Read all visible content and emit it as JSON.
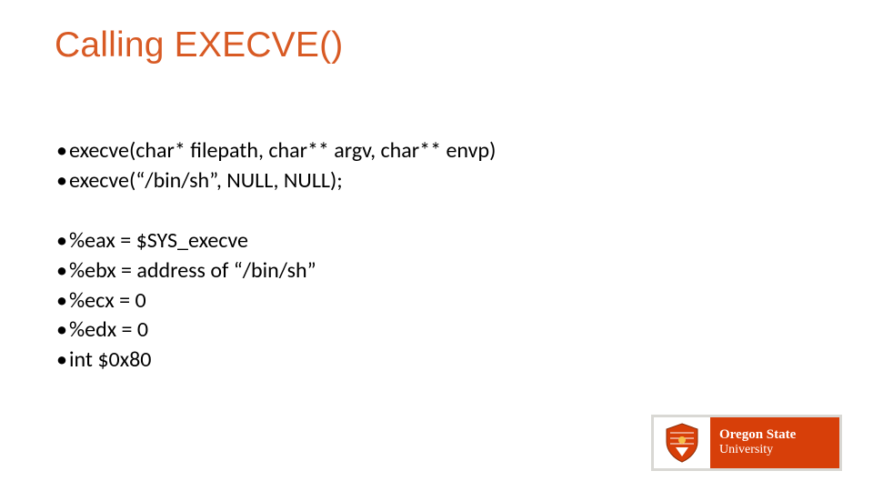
{
  "title": "Calling EXECVE()",
  "group1": [
    "execve(char* filepath, char** argv, char** envp)",
    "execve(“/bin/sh”, NULL, NULL);"
  ],
  "group2": [
    "%eax = $SYS_execve",
    "%ebx = address of “/bin/sh”",
    "%ecx = 0",
    "%edx = 0",
    "int $0x80"
  ],
  "logo": {
    "line1": "Oregon State",
    "line2": "University"
  }
}
